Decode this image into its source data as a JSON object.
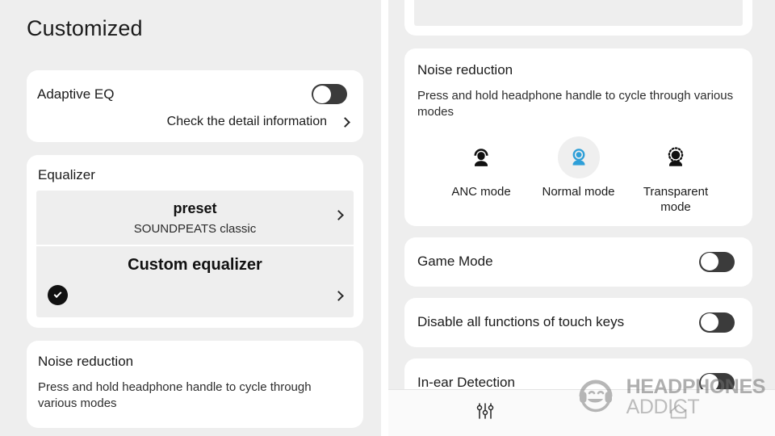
{
  "left_panel": {
    "page_title": "Customized",
    "adaptive_eq": {
      "label": "Adaptive EQ",
      "toggle_state": "off",
      "detail_link": "Check the detail information"
    },
    "equalizer": {
      "section_title": "Equalizer",
      "options": [
        {
          "title": "preset",
          "subtitle": "SOUNDPEATS classic",
          "selected": "false"
        },
        {
          "title": "Custom equalizer",
          "subtitle": "",
          "selected": "true"
        }
      ]
    },
    "noise_reduction": {
      "title": "Noise reduction",
      "description": "Press and hold headphone handle to cycle through various modes"
    }
  },
  "right_panel": {
    "noise_reduction": {
      "title": "Noise reduction",
      "description": "Press and hold headphone handle to cycle through various modes",
      "modes": [
        {
          "label": "ANC mode",
          "icon": "anc-person-waves-icon",
          "selected": "false"
        },
        {
          "label": "Normal mode",
          "icon": "normal-person-icon",
          "selected": "true"
        },
        {
          "label": "Transparent mode",
          "icon": "transparent-person-dotted-icon",
          "selected": "false"
        }
      ]
    },
    "toggles": [
      {
        "label": "Game Mode",
        "state": "off"
      },
      {
        "label": "Disable all functions of touch keys",
        "state": "off"
      },
      {
        "label": "In-ear Detection",
        "state": "off"
      }
    ],
    "bottom_nav": [
      {
        "icon": "equalizer-sliders-icon",
        "label": ""
      },
      {
        "icon": "home-icon",
        "label": ""
      }
    ]
  },
  "watermark": {
    "line1": "HEADPHONES",
    "line2": "ADDICT",
    "icon": "smiley-headphones-logo-icon"
  },
  "colors": {
    "panel_background": "#eeeeee",
    "card_background": "#ffffff",
    "toggle_track_off": "#3b3b3b",
    "accent_blue": "#2e9fd8",
    "selected_circle": "#efefef",
    "text_primary": "#1b1b1b"
  }
}
